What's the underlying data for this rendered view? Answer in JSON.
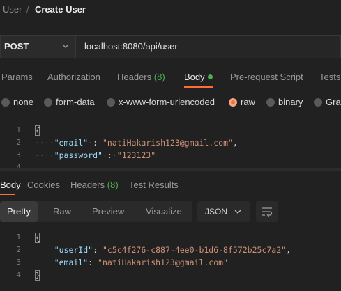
{
  "breadcrumb": {
    "parent": "User",
    "separator": "/",
    "current": "Create User"
  },
  "request": {
    "method": "POST",
    "url": "localhost:8080/api/user"
  },
  "request_tabs": [
    {
      "label": "Params"
    },
    {
      "label": "Authorization"
    },
    {
      "label": "Headers",
      "count": "(8)"
    },
    {
      "label": "Body"
    },
    {
      "label": "Pre-request Script"
    },
    {
      "label": "Tests"
    }
  ],
  "body_types": [
    {
      "label": "none"
    },
    {
      "label": "form-data"
    },
    {
      "label": "x-www-form-urlencoded"
    },
    {
      "label": "raw",
      "selected": true
    },
    {
      "label": "binary"
    },
    {
      "label": "GraphQL"
    }
  ],
  "request_body": {
    "line_numbers": [
      "1",
      "2",
      "3",
      "4"
    ],
    "open_brace": "{",
    "lines": [
      {
        "key": "\"email\"",
        "colon": ":",
        "value": "\"natiHakarish123@gmail.com\"",
        "trail": ","
      },
      {
        "key": "\"password\"",
        "colon": ":",
        "value": "\"123123\"",
        "trail": ""
      }
    ]
  },
  "response_tabs": [
    {
      "label": "Body"
    },
    {
      "label": "Cookies"
    },
    {
      "label": "Headers",
      "count": "(8)"
    },
    {
      "label": "Test Results"
    }
  ],
  "response_view": {
    "modes": [
      "Pretty",
      "Raw",
      "Preview",
      "Visualize"
    ],
    "format": "JSON"
  },
  "response_body": {
    "line_numbers": [
      "1",
      "2",
      "3",
      "4"
    ],
    "open_brace": "{",
    "close_brace": "}",
    "lines": [
      {
        "key": "\"userId\"",
        "colon": ":",
        "value": "\"c5c4f276-c887-4ee0-b1d6-8f572b25c7a2\"",
        "trail": ","
      },
      {
        "key": "\"email\"",
        "colon": ":",
        "value": "\"natiHakarish123@gmail.com\"",
        "trail": ""
      }
    ]
  },
  "colors": {
    "accent": "#ff6c37",
    "success": "#4caf50",
    "json_key": "#9cdcfe",
    "json_string": "#ce9178",
    "background": "#212121"
  },
  "icons": [
    "chevron-down-icon",
    "wrap-lines-icon"
  ]
}
